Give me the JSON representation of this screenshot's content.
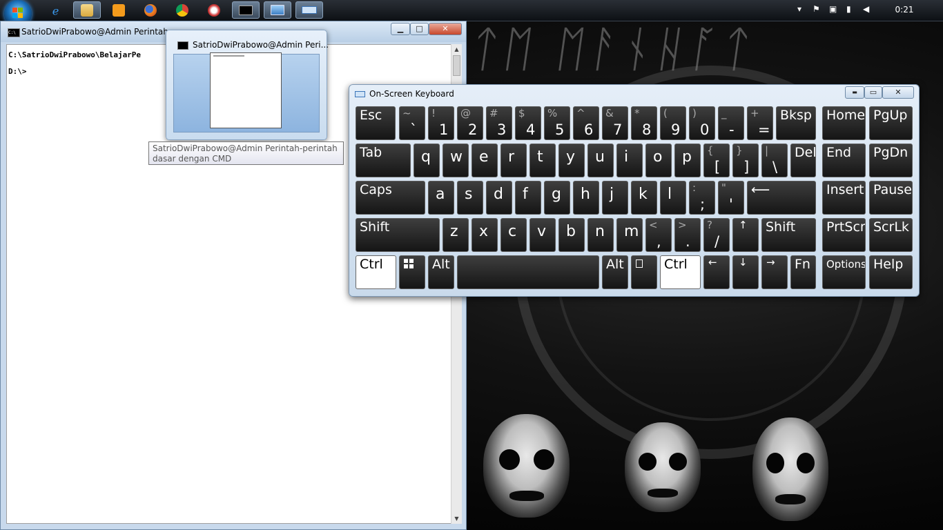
{
  "desktop": {
    "band_logo": "ᛏᛖ ᛖᚨᚾᚺᚪᛏ"
  },
  "taskbar": {
    "clock": "0:21",
    "pinned": [
      "internet-explorer-icon",
      "file-explorer-icon",
      "media-player-icon",
      "firefox-icon",
      "chrome-icon",
      "app-icon",
      "cmd-icon",
      "remote-desktop-icon",
      "keyboard-icon"
    ]
  },
  "cmd": {
    "title": "SatrioDwiPrabowo@Admin Perintah-pe",
    "icon_text": "C:\\",
    "lines": [
      "C:\\SatrioDwiPrabowo\\BelajarPe",
      "D:\\>"
    ],
    "minimize": "▁",
    "maximize": "□",
    "close": "✕"
  },
  "preview": {
    "title": "SatrioDwiPrabowo@Admin Peri..."
  },
  "tooltip": {
    "text": "SatrioDwiPrabowo@Admin Perintah-perintah dasar dengan CMD"
  },
  "osk": {
    "title": "On-Screen Keyboard",
    "minimize": "▬",
    "maximize": "▭",
    "close": "✕",
    "keys": {
      "esc": "Esc",
      "tilde_s": "~",
      "tilde": "`",
      "k1s": "!",
      "k1": "1",
      "k2s": "@",
      "k2": "2",
      "k3s": "#",
      "k3": "3",
      "k4s": "$",
      "k4": "4",
      "k5s": "%",
      "k5": "5",
      "k6s": "^",
      "k6": "6",
      "k7s": "&",
      "k7": "7",
      "k8s": "*",
      "k8": "8",
      "k9s": "(",
      "k9": "9",
      "k0s": ")",
      "k0": "0",
      "minus_s": "_",
      "minus": "-",
      "eq_s": "+",
      "eq": "=",
      "bksp": "Bksp",
      "home": "Home",
      "pgup": "PgUp",
      "tab": "Tab",
      "q": "q",
      "w": "w",
      "e": "e",
      "r": "r",
      "t": "t",
      "y": "y",
      "u": "u",
      "i": "i",
      "o": "o",
      "p": "p",
      "lbr_s": "{",
      "lbr": "[",
      "rbr_s": "}",
      "rbr": "]",
      "bs_s": "|",
      "bs": "\\",
      "del": "Del",
      "end": "End",
      "pgdn": "PgDn",
      "caps": "Caps",
      "a": "a",
      "s": "s",
      "d": "d",
      "f": "f",
      "g": "g",
      "h": "h",
      "j": "j",
      "k": "k",
      "l": "l",
      "semi_s": ":",
      "semi": ";",
      "quote_s": "\"",
      "quote": "'",
      "enter": "⟵",
      "insert": "Insert",
      "pause": "Pause",
      "shift": "Shift",
      "z": "z",
      "x": "x",
      "c": "c",
      "v": "v",
      "b": "b",
      "n": "n",
      "m": "m",
      "comma_s": "<",
      "comma": ",",
      "period_s": ">",
      "period": ".",
      "slash_s": "?",
      "slash": "/",
      "up": "↑",
      "rshift": "Shift",
      "prtscn": "PrtScn",
      "scrlk": "ScrLk",
      "ctrl": "Ctrl",
      "alt": "Alt",
      "ralt": "Alt",
      "rctrl": "Ctrl",
      "left": "←",
      "down": "↓",
      "right": "→",
      "fn": "Fn",
      "options": "Options",
      "help": "Help"
    }
  }
}
